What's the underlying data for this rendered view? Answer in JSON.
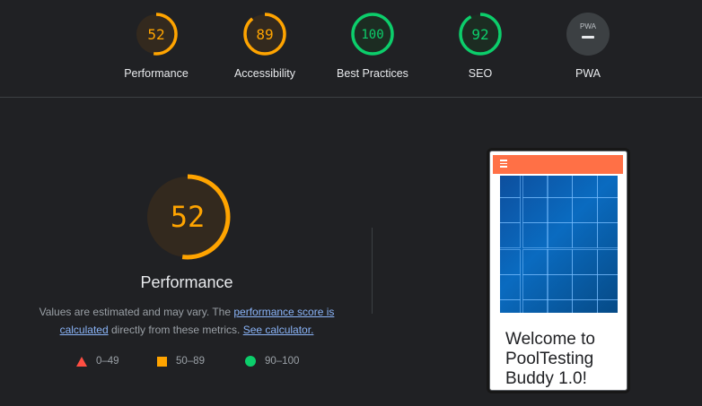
{
  "summary": {
    "items": [
      {
        "id": "performance",
        "score": "52",
        "label": "Performance",
        "percent": 52,
        "color": "#ffa400",
        "track": "#3a2d1c",
        "fill": "#33291e"
      },
      {
        "id": "accessibility",
        "score": "89",
        "label": "Accessibility",
        "percent": 89,
        "color": "#ffa400",
        "track": "#3a2d1c",
        "fill": "#33291e"
      },
      {
        "id": "best-practices",
        "score": "100",
        "label": "Best Practices",
        "percent": 100,
        "color": "#0cce6b",
        "track": "#1b3a28",
        "fill": "#1c2c22"
      },
      {
        "id": "seo",
        "score": "92",
        "label": "SEO",
        "percent": 92,
        "color": "#0cce6b",
        "track": "#1b3a28",
        "fill": "#1c2c22"
      },
      {
        "id": "pwa",
        "score": "PWA",
        "label": "PWA",
        "percent": 0,
        "color": "#9aa0a6",
        "track": "#3c4043",
        "fill": "#3c4043"
      }
    ]
  },
  "performance": {
    "score": "52",
    "percent": 52,
    "title": "Performance",
    "desc_prefix": "Values are estimated and may vary. The ",
    "desc_link1": "performance score is calculated",
    "desc_middle": " directly from these metrics. ",
    "desc_link2": "See calculator."
  },
  "legend": [
    {
      "shape": "triangle",
      "range": "0–49",
      "color": "#ff4e42"
    },
    {
      "shape": "square",
      "range": "50–89",
      "color": "#ffa400"
    },
    {
      "shape": "circle",
      "range": "90–100",
      "color": "#0cce6b"
    }
  ],
  "screenshot": {
    "header_color": "#ff7046",
    "heading": "Welcome to PoolTesting Buddy 1.0!"
  }
}
